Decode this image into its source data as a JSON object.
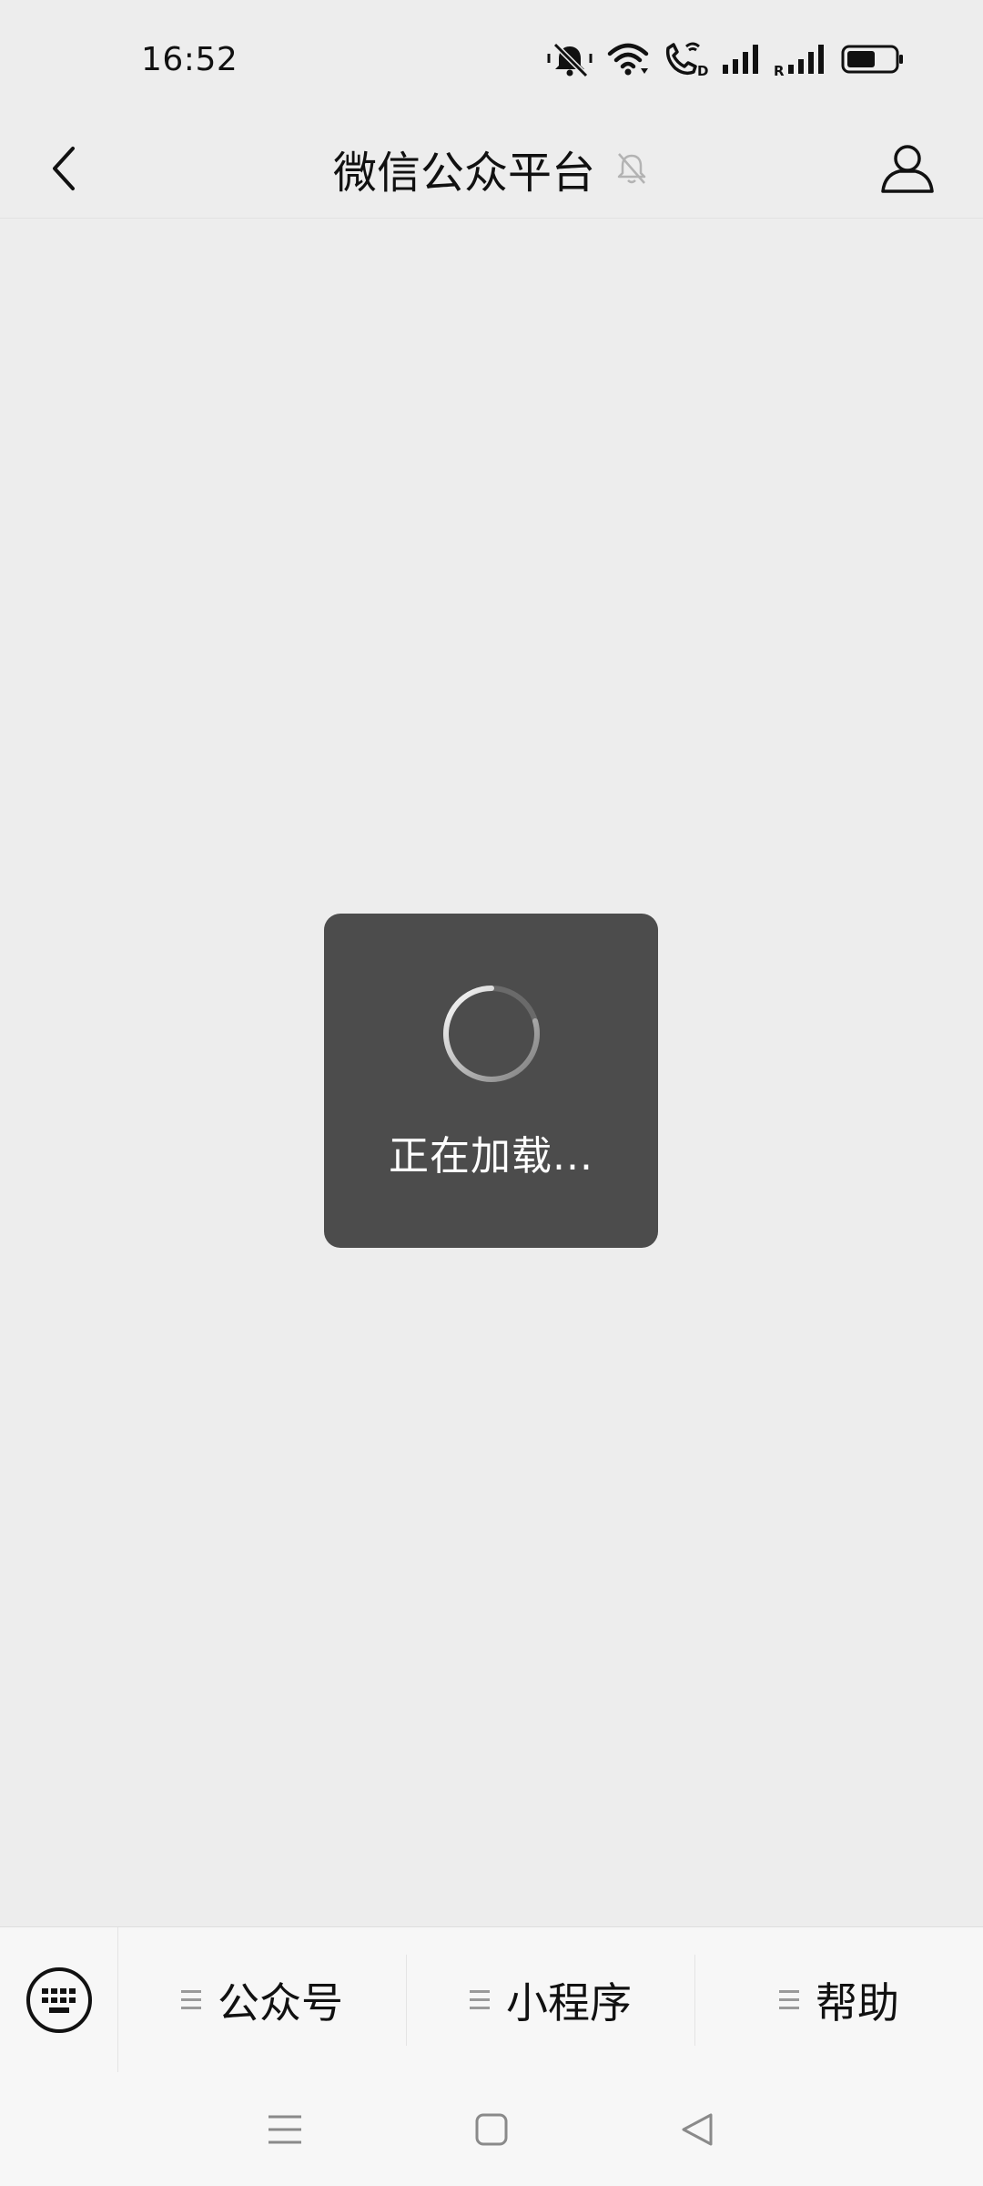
{
  "status_bar": {
    "time": "16:52",
    "icons": [
      "mute-bell-icon",
      "wifi-icon",
      "wifi-call-icon",
      "signal-icon",
      "roaming-signal-icon",
      "battery-icon"
    ],
    "battery_level": 0.6
  },
  "header": {
    "title": "微信公众平台",
    "back_icon": "chevron-left-icon",
    "mute_icon": "muted-bell-icon",
    "profile_icon": "user-icon"
  },
  "loading": {
    "text": "正在加载..."
  },
  "bottom_menu": {
    "keyboard_icon": "keyboard-icon",
    "items": [
      {
        "label": "公众号",
        "icon": "menu-lines-icon"
      },
      {
        "label": "小程序",
        "icon": "menu-lines-icon"
      },
      {
        "label": "帮助",
        "icon": "menu-lines-icon"
      }
    ]
  },
  "nav_bar": {
    "icons": [
      "menu-icon",
      "home-icon",
      "back-triangle-icon"
    ]
  },
  "colors": {
    "background": "#ededed",
    "toast": "#4c4c4c",
    "bottom_menu": "#f7f7f7"
  }
}
